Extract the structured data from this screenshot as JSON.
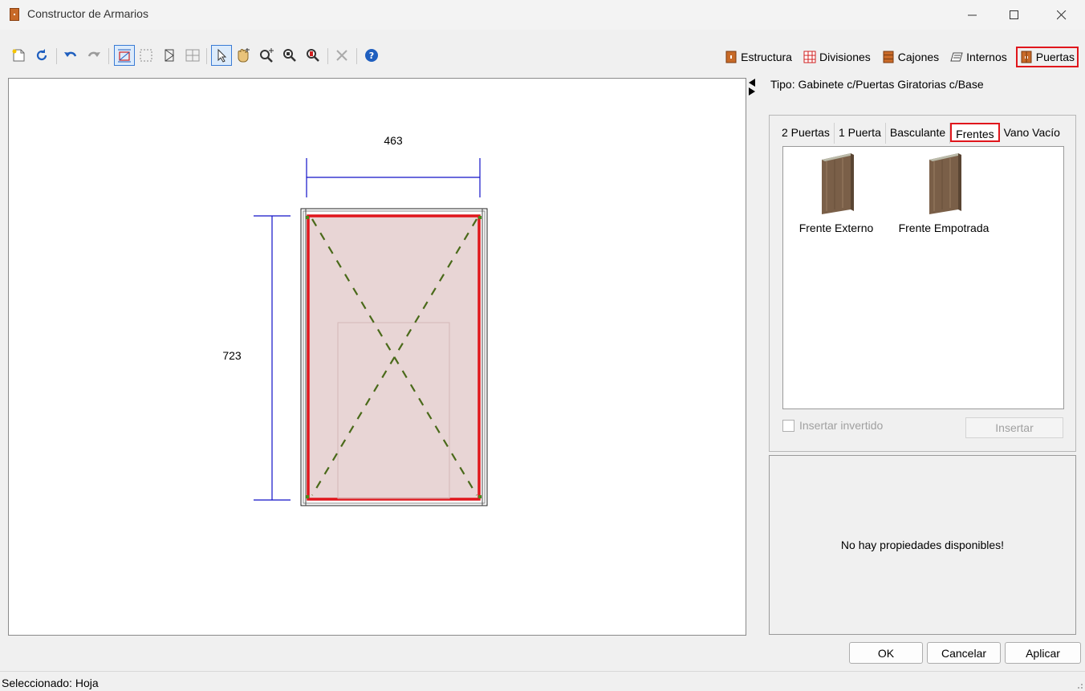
{
  "window": {
    "title": "Constructor de Armarios",
    "controls": [
      "minimize",
      "maximize",
      "close"
    ]
  },
  "toolbar": {
    "tools": [
      "new-icon",
      "refresh-icon",
      "undo-icon",
      "redo-icon",
      "dimension-toggle-icon",
      "select-region-icon",
      "door-icon",
      "grid-icon",
      "pointer-icon",
      "pan-hand-icon",
      "zoom-in-icon",
      "zoom-window-icon",
      "zoom-extents-icon",
      "delete-icon",
      "help-icon"
    ]
  },
  "modes": [
    {
      "label": "Estructura",
      "icon": "structure-icon"
    },
    {
      "label": "Divisiones",
      "icon": "divisions-icon"
    },
    {
      "label": "Cajones",
      "icon": "drawers-icon"
    },
    {
      "label": "Internos",
      "icon": "internals-icon"
    },
    {
      "label": "Puertas",
      "icon": "doors-icon",
      "selected": true
    }
  ],
  "canvas": {
    "width_dim": "463",
    "height_dim": "723"
  },
  "tipo": "Tipo: Gabinete c/Puertas Giratorias c/Base",
  "tabs": [
    {
      "label": "2 Puertas"
    },
    {
      "label": "1 Puerta"
    },
    {
      "label": "Basculante"
    },
    {
      "label": "Frentes",
      "selected": true
    },
    {
      "label": "Vano Vacío"
    }
  ],
  "items": [
    {
      "label": "Frente Externo"
    },
    {
      "label": "Frente Empotrada"
    }
  ],
  "insert_inverted": "Insertar invertido",
  "insert_button": "Insertar",
  "properties_empty": "No hay propiedades disponibles!",
  "buttons": {
    "ok": "OK",
    "cancel": "Cancelar",
    "apply": "Aplicar"
  },
  "status": "Seleccionado: Hoja",
  "colors": {
    "accent_red": "#e0161c",
    "dimension_blue": "#1010c8",
    "door_fill": "#e8d5d5",
    "diagonal_green": "#4a6a1a"
  }
}
